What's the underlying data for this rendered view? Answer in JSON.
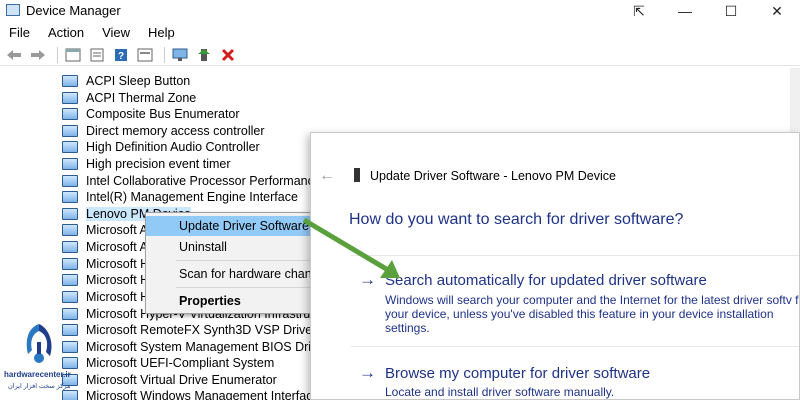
{
  "window": {
    "title": "Device Manager",
    "buttons": [
      "⇱",
      "—",
      "☐",
      "✕"
    ]
  },
  "menu": [
    "File",
    "Action",
    "View",
    "Help"
  ],
  "toolbar": {
    "icons": [
      "back-arrow-icon",
      "forward-arrow-icon",
      "show-hide-tree-icon",
      "properties-icon",
      "help-icon",
      "view-icon",
      "monitor-icon",
      "update-driver-icon",
      "uninstall-x-icon"
    ]
  },
  "tree": {
    "items": [
      "ACPI Sleep Button",
      "ACPI Thermal Zone",
      "Composite Bus Enumerator",
      "Direct memory access controller",
      "High Definition Audio Controller",
      "High precision event timer",
      "Intel Collaborative Processor Performance",
      "Intel(R) Management Engine Interface",
      "Lenovo PM Device",
      "Microsoft A",
      "Microsoft A",
      "Microsoft H",
      "Microsoft H",
      "Microsoft H",
      "Microsoft Hyper-V Virtualization Infrastru",
      "Microsoft RemoteFX Synth3D VSP Driver",
      "Microsoft System Management BIOS Drive",
      "Microsoft UEFI-Compliant System",
      "Microsoft Virtual Drive Enumerator",
      "Microsoft Windows Management Interfac"
    ],
    "selected_index": 8
  },
  "context_menu": {
    "items": [
      "Update Driver Software...",
      "Uninstall",
      "Scan for hardware chang",
      "Properties"
    ],
    "highlighted_index": 0
  },
  "dialog": {
    "back": "←",
    "title": "Update Driver Software - Lenovo PM Device",
    "question": "How do you want to search for driver software?",
    "options": [
      {
        "arrow": "→",
        "title": "Search automatically for updated driver software",
        "description": "Windows will search your computer and the Internet for the latest driver softv for your device, unless you've disabled this feature in your device installation settings."
      },
      {
        "arrow": "→",
        "title": "Browse my computer for driver software",
        "description": "Locate and install driver software manually."
      }
    ]
  },
  "watermark": {
    "name": "hardwarecenter.ir",
    "tagline": "مرکز سخت افزار ایران"
  },
  "colors": {
    "link_blue": "#1e3287",
    "selection": "#cce8ff",
    "menu_highlight": "#91c9f7",
    "annotation_arrow": "#5aa03c"
  }
}
